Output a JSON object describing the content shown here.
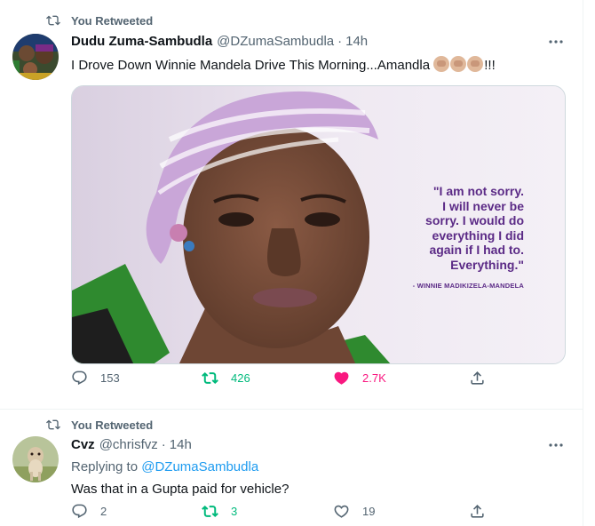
{
  "tweets": [
    {
      "social_context": "You Retweeted",
      "author_name": "Dudu Zuma-Sambudla",
      "author_handle": "@DZumaSambudla",
      "separator": "·",
      "time": "14h",
      "text": "I Drove Down Winnie Mandela Drive This Morning...Amandla ",
      "text_suffix": "!!!",
      "media": {
        "quote_lines": [
          "\"I am not sorry.",
          "I will never be",
          "sorry. I would do",
          "everything I did",
          "again if I had to.",
          "Everything.\""
        ],
        "quote_author": "- WINNIE MADIKIZELA-MANDELA"
      },
      "replies": "153",
      "retweets": "426",
      "likes": "2.7K"
    },
    {
      "social_context": "You Retweeted",
      "author_name": "Cvz",
      "author_handle": "@chrisfvz",
      "separator": "·",
      "time": "14h",
      "replying_prefix": "Replying to ",
      "replying_to": "@DZumaSambudla",
      "text": "Was that in a Gupta paid for vehicle?",
      "replies": "2",
      "retweets": "3",
      "likes": "19"
    }
  ],
  "colors": {
    "retweet_green": "#00ba7c",
    "like_pink": "#f91880",
    "link_blue": "#1d9bf0",
    "secondary_text": "#536471",
    "quote_purple": "#5b2a86"
  },
  "icons": {
    "social_context": "retweet-icon",
    "more": "more-dots-icon",
    "reply": "reply-icon",
    "retweet": "retweet-icon",
    "like": "heart-icon",
    "share": "share-icon"
  }
}
